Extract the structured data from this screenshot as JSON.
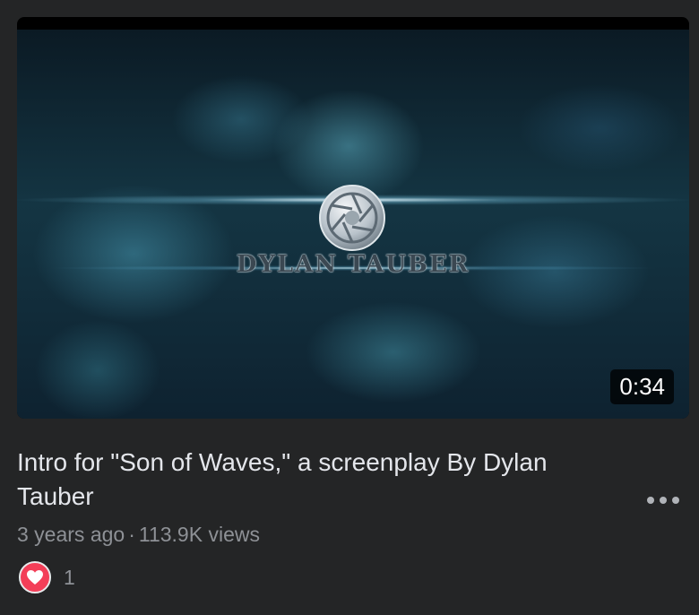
{
  "video": {
    "duration": "0:34",
    "title": "Intro for \"Son of Waves,\" a screenplay By Dylan Tauber",
    "age": "3 years ago",
    "separator": "·",
    "views": "113.9K views",
    "thumbnail_logo_text": "DYLAN TAUBER"
  },
  "reactions": {
    "icon": "heart-icon",
    "count": "1"
  },
  "icons": {
    "more": "more-options-icon",
    "logo": "aperture-logo-icon"
  },
  "colors": {
    "background": "#242526",
    "title_text": "#e4e6eb",
    "meta_text": "#8e9196",
    "heart": "#f33e58"
  }
}
